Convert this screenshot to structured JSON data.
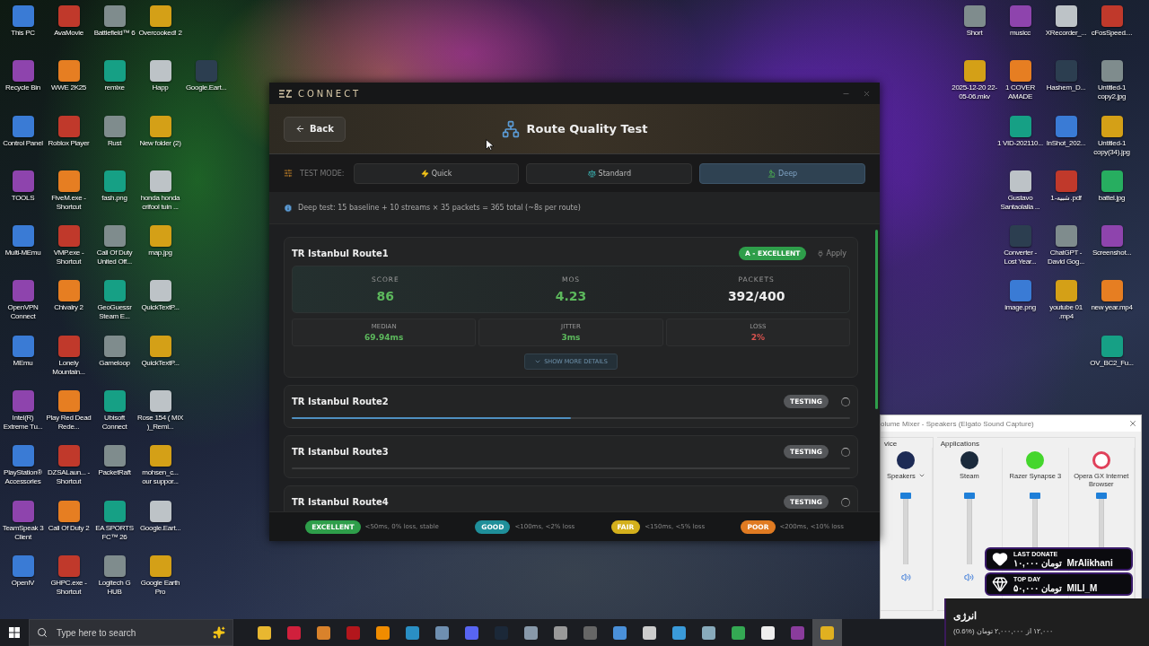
{
  "desktop": {
    "left_icons": [
      [
        "This PC",
        "AvaMovie",
        "Battlefield™ 6",
        "Overcooked! 2"
      ],
      [
        "Recycle Bin",
        "WWE 2K25",
        "remixe",
        "Happ",
        "Google.Eart..."
      ],
      [
        "Control Panel",
        "Roblox Player",
        "Rust",
        "New folder (2)"
      ],
      [
        "TOOLS",
        "FiveM.exe - Shortcut",
        "fash.png",
        "honda honda crifool tuin ..."
      ],
      [
        "Multi-MEmu",
        "VMP.exe - Shortcut",
        "Call Of Duty United Off...",
        "map.jpg"
      ],
      [
        "OpenVPN Connect",
        "Chivalry 2",
        "GeoGuessr Steam E...",
        "QuickTextP..."
      ],
      [
        "MEmu",
        "Lonely Mountain...",
        "Gameloop",
        "QuickTextP..."
      ],
      [
        "Intel(R) Extreme Tu...",
        "Play Red Dead Rede...",
        "Ubisoft Connect",
        "Rose 154 ( MiX )_Remi..."
      ],
      [
        "PlayStation® Accessories",
        "DZSALaun... - Shortcut",
        "PacketRaft",
        "mohsen_c... our suppor..."
      ],
      [
        "TeamSpeak 3 Client",
        "Call Of Duty 2",
        "EA SPORTS FC™ 26",
        "Google.Eart..."
      ],
      [
        "OpenIV",
        "GHPC.exe - Shortcut",
        "Logitech G HUB",
        "Google Earth Pro"
      ]
    ],
    "right_icons": [
      [
        "Short",
        "2025-12-20 22-05-06.mkv"
      ],
      [
        "musicc",
        "1 COVER AMADE",
        "1 VID-202110...",
        "Gustavo Santaolalla ...",
        "Converter - Lost Year...",
        "image.png"
      ],
      [
        "XRecorder_...",
        "Hashem_D...",
        "InShot_202...",
        "1-شبیه.pdf",
        "ChatGPT - David Gog...",
        "youtube 01 .mp4"
      ],
      [
        "cFosSpeed....",
        "Untitled-1 copy2.jpg",
        "Untitled-1 copy(34).jpg",
        "battel.jpg",
        "Screenshot...",
        "new year.mp4",
        "OV_BC2_Fu..."
      ]
    ]
  },
  "app": {
    "brand": "CONNECT",
    "back": "Back",
    "title": "Route Quality Test",
    "mode_label": "TEST MODE:",
    "modes": [
      {
        "label": "Quick",
        "kind": "quick",
        "selected": false
      },
      {
        "label": "Standard",
        "kind": "standard",
        "selected": false
      },
      {
        "label": "Deep",
        "kind": "deep",
        "selected": true
      }
    ],
    "info": "Deep test: 15 baseline + 10 streams × 35 packets = 365 total (~8s per route)",
    "routes": [
      {
        "name": "TR Istanbul Route1",
        "kind": "result",
        "grade": "A - EXCELLENT",
        "apply": {
          "label": "Apply",
          "disabled": true
        },
        "stats": [
          {
            "label": "SCORE",
            "value": "86",
            "color": "#5cb85c"
          },
          {
            "label": "MOS",
            "value": "4.23",
            "color": "#5cb85c"
          },
          {
            "label": "PACKETS",
            "value": "392/400",
            "color": "#eeeeee"
          }
        ],
        "metrics": [
          {
            "label": "MEDIAN",
            "value": "69.94ms",
            "color": "#5cb85c"
          },
          {
            "label": "JITTER",
            "value": "3ms",
            "color": "#5cb85c"
          },
          {
            "label": "LOSS",
            "value": "2%",
            "color": "#d9534f"
          }
        ],
        "details_button": "SHOW MORE DETAILS"
      },
      {
        "name": "TR Istanbul Route2",
        "kind": "testing",
        "status": "TESTING",
        "level": 0.5
      },
      {
        "name": "TR Istanbul Route3",
        "kind": "testing",
        "status": "TESTING",
        "level": 0
      },
      {
        "name": "TR Istanbul Route4",
        "kind": "testing",
        "status": "TESTING"
      }
    ],
    "legend": [
      {
        "label": "EXCELLENT",
        "desc": "<50ms, 0% loss, stable",
        "color": "#2e9e4a"
      },
      {
        "label": "GOOD",
        "desc": "<100ms, <2% loss",
        "color": "#1f8f9a"
      },
      {
        "label": "FAIR",
        "desc": "<150ms, <5% loss",
        "color": "#d4b01c"
      },
      {
        "label": "POOR",
        "desc": "<200ms, <10% loss",
        "color": "#e07b22"
      }
    ]
  },
  "mixer": {
    "title": "olume Mixer - Speakers (Elgato Sound Capture)",
    "device_label": "vice",
    "apps_label": "Applications",
    "channels": [
      {
        "name": "Speakers",
        "kind": "device",
        "level": 1
      },
      {
        "name": "Steam",
        "kind": "steam",
        "level": 1
      },
      {
        "name": "Razer Synapse 3",
        "kind": "razer",
        "level": 1
      },
      {
        "name": "Opera GX Internet Browser",
        "kind": "opera",
        "level": 1
      }
    ]
  },
  "donations": [
    {
      "kind": "heart",
      "heading": "LAST DONATE",
      "amount": "۱۰,۰۰۰ تومان",
      "name": "MrAlikhani"
    },
    {
      "kind": "diamond",
      "heading": "TOP DAY",
      "amount": "۵۰,۰۰۰ تومان",
      "name": "MILI_M"
    }
  ],
  "notification": {
    "title": "انرژی",
    "body": "۱۲,۰۰۰ از ۲,۰۰۰,۰۰۰ تومان (%0.6)"
  },
  "taskbar": {
    "search_placeholder": "Type here to search"
  }
}
